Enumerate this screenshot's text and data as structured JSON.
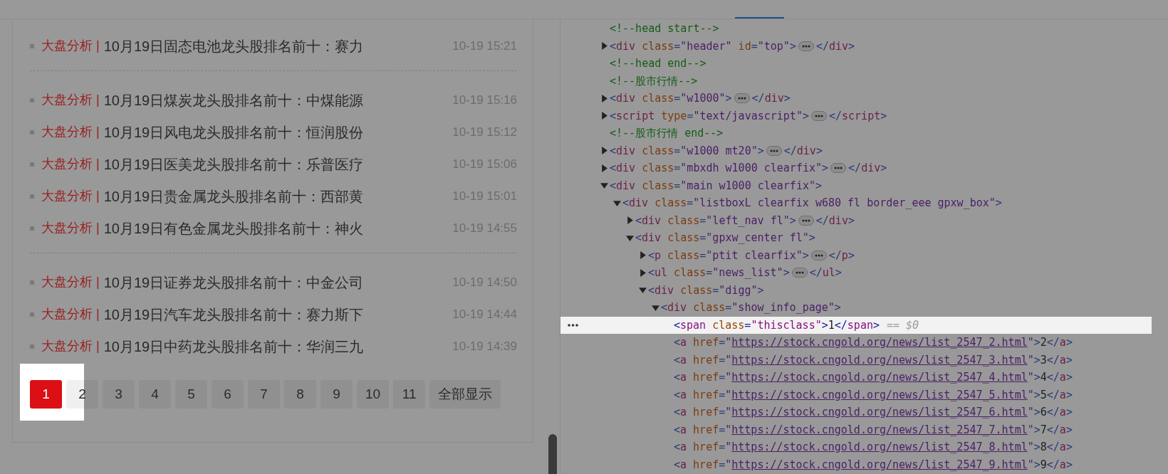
{
  "news_list": {
    "groups": [
      {
        "items": [
          {
            "category": "大盘分析 |",
            "title": "10月19日固态电池龙头股排名前十：赛力",
            "time": "10-19 15:21"
          }
        ]
      },
      {
        "items": [
          {
            "category": "大盘分析 |",
            "title": "10月19日煤炭龙头股排名前十：中煤能源",
            "time": "10-19 15:16"
          },
          {
            "category": "大盘分析 |",
            "title": "10月19日风电龙头股排名前十：恒润股份",
            "time": "10-19 15:12"
          },
          {
            "category": "大盘分析 |",
            "title": "10月19日医美龙头股排名前十：乐普医疗",
            "time": "10-19 15:06"
          },
          {
            "category": "大盘分析 |",
            "title": "10月19日贵金属龙头股排名前十：西部黄",
            "time": "10-19 15:01"
          },
          {
            "category": "大盘分析 |",
            "title": "10月19日有色金属龙头股排名前十：神火",
            "time": "10-19 14:55"
          }
        ]
      },
      {
        "items": [
          {
            "category": "大盘分析 |",
            "title": "10月19日证券龙头股排名前十：中金公司",
            "time": "10-19 14:50"
          },
          {
            "category": "大盘分析 |",
            "title": "10月19日汽车龙头股排名前十：赛力斯下",
            "time": "10-19 14:44"
          },
          {
            "category": "大盘分析 |",
            "title": "10月19日中药龙头股排名前十：华润三九",
            "time": "10-19 14:39"
          }
        ]
      }
    ]
  },
  "pagination": [
    {
      "label": "1",
      "selected": true
    },
    {
      "label": "2",
      "selected": false
    },
    {
      "label": "3",
      "selected": false
    },
    {
      "label": "4",
      "selected": false
    },
    {
      "label": "5",
      "selected": false
    },
    {
      "label": "6",
      "selected": false
    },
    {
      "label": "7",
      "selected": false
    },
    {
      "label": "8",
      "selected": false
    },
    {
      "label": "9",
      "selected": false
    },
    {
      "label": "10",
      "selected": false
    },
    {
      "label": "11",
      "selected": false
    },
    {
      "label": "全部显示",
      "selected": false
    }
  ],
  "dom_tree": [
    {
      "kind": "comment",
      "selected": false,
      "open": [
        {
          "comment": "<!--head start-->"
        }
      ]
    },
    {
      "kind": "element",
      "selected": false,
      "expanded": false,
      "open": [
        {
          "punct": "<"
        },
        {
          "tag": "div"
        },
        {
          "attr": " class"
        },
        {
          "punct": "="
        },
        {
          "value": "\"header\""
        },
        {
          "attr": " id"
        },
        {
          "punct": "="
        },
        {
          "value": "\"top\""
        },
        {
          "punct": ">"
        }
      ],
      "close": [
        {
          "punct": "</"
        },
        {
          "tag": "div"
        },
        {
          "punct": ">"
        }
      ]
    },
    {
      "kind": "comment",
      "selected": false,
      "open": [
        {
          "comment": "<!--head end-->"
        }
      ]
    },
    {
      "kind": "comment",
      "selected": false,
      "open": [
        {
          "comment": "<!--股市行情-->"
        }
      ]
    },
    {
      "kind": "element",
      "selected": false,
      "expanded": false,
      "open": [
        {
          "punct": "<"
        },
        {
          "tag": "div"
        },
        {
          "attr": " class"
        },
        {
          "punct": "="
        },
        {
          "value": "\"w1000\""
        },
        {
          "punct": ">"
        }
      ],
      "close": [
        {
          "punct": "</"
        },
        {
          "tag": "div"
        },
        {
          "punct": ">"
        }
      ]
    },
    {
      "kind": "element",
      "selected": false,
      "expanded": false,
      "open": [
        {
          "punct": "<"
        },
        {
          "tag": "script"
        },
        {
          "attr": " type"
        },
        {
          "punct": "="
        },
        {
          "value": "\"text/javascript\""
        },
        {
          "punct": ">"
        }
      ],
      "close": [
        {
          "punct": "</"
        },
        {
          "tag": "script"
        },
        {
          "punct": ">"
        }
      ]
    },
    {
      "kind": "comment",
      "selected": false,
      "open": [
        {
          "comment": "<!--股市行情 end-->"
        }
      ]
    },
    {
      "kind": "element",
      "selected": false,
      "expanded": false,
      "open": [
        {
          "punct": "<"
        },
        {
          "tag": "div"
        },
        {
          "attr": " class"
        },
        {
          "punct": "="
        },
        {
          "value": "\"w1000 mt20\""
        },
        {
          "punct": ">"
        }
      ],
      "close": [
        {
          "punct": "</"
        },
        {
          "tag": "div"
        },
        {
          "punct": ">"
        }
      ]
    },
    {
      "kind": "element",
      "selected": false,
      "expanded": false,
      "open": [
        {
          "punct": "<"
        },
        {
          "tag": "div"
        },
        {
          "attr": " class"
        },
        {
          "punct": "="
        },
        {
          "value": "\"mbxdh w1000 clearfix\""
        },
        {
          "punct": ">"
        }
      ],
      "close": [
        {
          "punct": "</"
        },
        {
          "tag": "div"
        },
        {
          "punct": ">"
        }
      ]
    },
    {
      "kind": "element",
      "selected": false,
      "expanded": true,
      "open": [
        {
          "punct": "<"
        },
        {
          "tag": "div"
        },
        {
          "attr": " class"
        },
        {
          "punct": "="
        },
        {
          "value": "\"main w1000 clearfix\""
        },
        {
          "punct": ">"
        }
      ],
      "children": [
        {
          "kind": "element",
          "selected": false,
          "expanded": true,
          "open": [
            {
              "punct": "<"
            },
            {
              "tag": "div"
            },
            {
              "attr": " class"
            },
            {
              "punct": "="
            },
            {
              "value": "\"listboxL clearfix w680 fl border_eee gpxw_box\""
            },
            {
              "punct": ">"
            }
          ],
          "children": [
            {
              "kind": "element",
              "selected": false,
              "expanded": false,
              "open": [
                {
                  "punct": "<"
                },
                {
                  "tag": "div"
                },
                {
                  "attr": " class"
                },
                {
                  "punct": "="
                },
                {
                  "value": "\"left_nav fl\""
                },
                {
                  "punct": ">"
                }
              ],
              "close": [
                {
                  "punct": "</"
                },
                {
                  "tag": "div"
                },
                {
                  "punct": ">"
                }
              ]
            },
            {
              "kind": "element",
              "selected": false,
              "expanded": true,
              "open": [
                {
                  "punct": "<"
                },
                {
                  "tag": "div"
                },
                {
                  "attr": " class"
                },
                {
                  "punct": "="
                },
                {
                  "value": "\"gpxw_center fl\""
                },
                {
                  "punct": ">"
                }
              ],
              "children": [
                {
                  "kind": "element",
                  "selected": false,
                  "expanded": false,
                  "open": [
                    {
                      "punct": "<"
                    },
                    {
                      "tag": "p"
                    },
                    {
                      "attr": " class"
                    },
                    {
                      "punct": "="
                    },
                    {
                      "value": "\"ptit clearfix\""
                    },
                    {
                      "punct": ">"
                    }
                  ],
                  "close": [
                    {
                      "punct": "</"
                    },
                    {
                      "tag": "p"
                    },
                    {
                      "punct": ">"
                    }
                  ]
                },
                {
                  "kind": "element",
                  "selected": false,
                  "expanded": false,
                  "open": [
                    {
                      "punct": "<"
                    },
                    {
                      "tag": "ul"
                    },
                    {
                      "attr": " class"
                    },
                    {
                      "punct": "="
                    },
                    {
                      "value": "\"news_list\""
                    },
                    {
                      "punct": ">"
                    }
                  ],
                  "close": [
                    {
                      "punct": "</"
                    },
                    {
                      "tag": "ul"
                    },
                    {
                      "punct": ">"
                    }
                  ]
                },
                {
                  "kind": "element",
                  "selected": false,
                  "expanded": true,
                  "open": [
                    {
                      "punct": "<"
                    },
                    {
                      "tag": "div"
                    },
                    {
                      "attr": " class"
                    },
                    {
                      "punct": "="
                    },
                    {
                      "value": "\"digg\""
                    },
                    {
                      "punct": ">"
                    }
                  ],
                  "children": [
                    {
                      "kind": "element",
                      "selected": false,
                      "expanded": true,
                      "open": [
                        {
                          "punct": "<"
                        },
                        {
                          "tag": "div"
                        },
                        {
                          "attr": " class"
                        },
                        {
                          "punct": "="
                        },
                        {
                          "value": "\"show_info_page\""
                        },
                        {
                          "punct": ">"
                        }
                      ],
                      "children": [
                        {
                          "kind": "element",
                          "selected": true,
                          "note": "== $0",
                          "open": [
                            {
                              "punct": "<"
                            },
                            {
                              "tag": "span"
                            },
                            {
                              "attr": " class"
                            },
                            {
                              "punct": "="
                            },
                            {
                              "value": "\"thisclass\""
                            },
                            {
                              "punct": ">"
                            },
                            {
                              "text": "1"
                            },
                            {
                              "punct": "</"
                            },
                            {
                              "tag": "span"
                            },
                            {
                              "punct": ">"
                            }
                          ]
                        },
                        {
                          "kind": "element",
                          "selected": false,
                          "open": [
                            {
                              "punct": "<"
                            },
                            {
                              "tag": "a"
                            },
                            {
                              "attr": " href"
                            },
                            {
                              "punct": "="
                            },
                            {
                              "value": "\""
                            },
                            {
                              "url": "https://stock.cngold.org/news/list_2547_2.html"
                            },
                            {
                              "value": "\""
                            },
                            {
                              "punct": ">"
                            },
                            {
                              "text": "2"
                            },
                            {
                              "punct": "</"
                            },
                            {
                              "tag": "a"
                            },
                            {
                              "punct": ">"
                            }
                          ]
                        },
                        {
                          "kind": "element",
                          "selected": false,
                          "open": [
                            {
                              "punct": "<"
                            },
                            {
                              "tag": "a"
                            },
                            {
                              "attr": " href"
                            },
                            {
                              "punct": "="
                            },
                            {
                              "value": "\""
                            },
                            {
                              "url": "https://stock.cngold.org/news/list_2547_3.html"
                            },
                            {
                              "value": "\""
                            },
                            {
                              "punct": ">"
                            },
                            {
                              "text": "3"
                            },
                            {
                              "punct": "</"
                            },
                            {
                              "tag": "a"
                            },
                            {
                              "punct": ">"
                            }
                          ]
                        },
                        {
                          "kind": "element",
                          "selected": false,
                          "open": [
                            {
                              "punct": "<"
                            },
                            {
                              "tag": "a"
                            },
                            {
                              "attr": " href"
                            },
                            {
                              "punct": "="
                            },
                            {
                              "value": "\""
                            },
                            {
                              "url": "https://stock.cngold.org/news/list_2547_4.html"
                            },
                            {
                              "value": "\""
                            },
                            {
                              "punct": ">"
                            },
                            {
                              "text": "4"
                            },
                            {
                              "punct": "</"
                            },
                            {
                              "tag": "a"
                            },
                            {
                              "punct": ">"
                            }
                          ]
                        },
                        {
                          "kind": "element",
                          "selected": false,
                          "open": [
                            {
                              "punct": "<"
                            },
                            {
                              "tag": "a"
                            },
                            {
                              "attr": " href"
                            },
                            {
                              "punct": "="
                            },
                            {
                              "value": "\""
                            },
                            {
                              "url": "https://stock.cngold.org/news/list_2547_5.html"
                            },
                            {
                              "value": "\""
                            },
                            {
                              "punct": ">"
                            },
                            {
                              "text": "5"
                            },
                            {
                              "punct": "</"
                            },
                            {
                              "tag": "a"
                            },
                            {
                              "punct": ">"
                            }
                          ]
                        },
                        {
                          "kind": "element",
                          "selected": false,
                          "open": [
                            {
                              "punct": "<"
                            },
                            {
                              "tag": "a"
                            },
                            {
                              "attr": " href"
                            },
                            {
                              "punct": "="
                            },
                            {
                              "value": "\""
                            },
                            {
                              "url": "https://stock.cngold.org/news/list_2547_6.html"
                            },
                            {
                              "value": "\""
                            },
                            {
                              "punct": ">"
                            },
                            {
                              "text": "6"
                            },
                            {
                              "punct": "</"
                            },
                            {
                              "tag": "a"
                            },
                            {
                              "punct": ">"
                            }
                          ]
                        },
                        {
                          "kind": "element",
                          "selected": false,
                          "open": [
                            {
                              "punct": "<"
                            },
                            {
                              "tag": "a"
                            },
                            {
                              "attr": " href"
                            },
                            {
                              "punct": "="
                            },
                            {
                              "value": "\""
                            },
                            {
                              "url": "https://stock.cngold.org/news/list_2547_7.html"
                            },
                            {
                              "value": "\""
                            },
                            {
                              "punct": ">"
                            },
                            {
                              "text": "7"
                            },
                            {
                              "punct": "</"
                            },
                            {
                              "tag": "a"
                            },
                            {
                              "punct": ">"
                            }
                          ]
                        },
                        {
                          "kind": "element",
                          "selected": false,
                          "open": [
                            {
                              "punct": "<"
                            },
                            {
                              "tag": "a"
                            },
                            {
                              "attr": " href"
                            },
                            {
                              "punct": "="
                            },
                            {
                              "value": "\""
                            },
                            {
                              "url": "https://stock.cngold.org/news/list_2547_8.html"
                            },
                            {
                              "value": "\""
                            },
                            {
                              "punct": ">"
                            },
                            {
                              "text": "8"
                            },
                            {
                              "punct": "</"
                            },
                            {
                              "tag": "a"
                            },
                            {
                              "punct": ">"
                            }
                          ]
                        },
                        {
                          "kind": "element",
                          "selected": false,
                          "open": [
                            {
                              "punct": "<"
                            },
                            {
                              "tag": "a"
                            },
                            {
                              "attr": " href"
                            },
                            {
                              "punct": "="
                            },
                            {
                              "value": "\""
                            },
                            {
                              "url": "https://stock.cngold.org/news/list_2547_9.html"
                            },
                            {
                              "value": "\""
                            },
                            {
                              "punct": ">"
                            },
                            {
                              "text": "9"
                            },
                            {
                              "punct": "</"
                            },
                            {
                              "tag": "a"
                            },
                            {
                              "punct": ">"
                            }
                          ]
                        }
                      ]
                    }
                  ]
                }
              ]
            }
          ]
        }
      ]
    }
  ]
}
